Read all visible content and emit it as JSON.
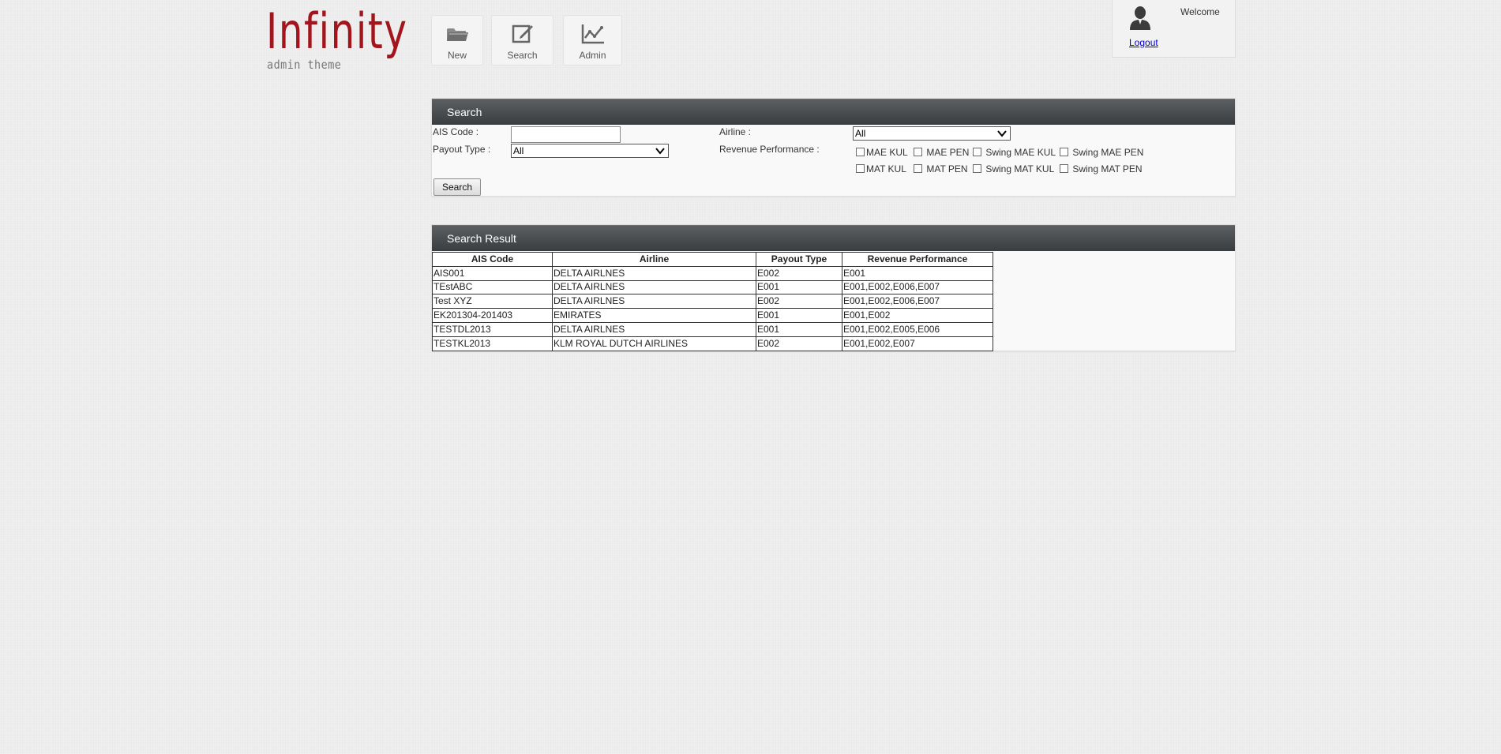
{
  "brand": {
    "name": "Infinity",
    "tagline": "admin theme",
    "color": "#a3151c"
  },
  "nav": [
    {
      "label": "New",
      "icon": "folder-icon"
    },
    {
      "label": "Search",
      "icon": "edit-icon"
    },
    {
      "label": "Admin",
      "icon": "chart-icon"
    }
  ],
  "user": {
    "welcome": "Welcome",
    "logout": "Logout",
    "icon": "user-icon"
  },
  "search_panel": {
    "title": "Search",
    "ais_code_label": "AIS Code :",
    "ais_code_value": "",
    "airline_label": "Airline :",
    "airline_selected": "All",
    "payout_type_label": "Payout Type :",
    "payout_type_selected": "All",
    "revenue_label": "Revenue Performance :",
    "revenue_options": [
      "MAE KUL",
      "MAE PEN",
      "Swing MAE KUL",
      "Swing MAE PEN",
      "MAT KUL",
      "MAT PEN",
      "Swing MAT KUL",
      "Swing MAT PEN"
    ],
    "search_button": "Search"
  },
  "result_panel": {
    "title": "Search Result",
    "columns": [
      "AIS Code",
      "Airline",
      "Payout Type",
      "Revenue Performance"
    ],
    "rows": [
      [
        "AIS001",
        "DELTA AIRLNES",
        "E002",
        "E001"
      ],
      [
        "TEstABC",
        "DELTA AIRLNES",
        "E001",
        "E001,E002,E006,E007"
      ],
      [
        "Test XYZ",
        "DELTA AIRLNES",
        "E002",
        "E001,E002,E006,E007"
      ],
      [
        "EK201304-201403",
        "EMIRATES",
        "E001",
        "E001,E002"
      ],
      [
        "TESTDL2013",
        "DELTA AIRLNES",
        "E001",
        "E001,E002,E005,E006"
      ],
      [
        "TESTKL2013",
        "KLM ROYAL DUTCH AIRLINES",
        "E002",
        "E001,E002,E007"
      ]
    ]
  },
  "colors": {
    "panel_header": "#4a4d50",
    "link": "#0000cc",
    "background": "#efefef"
  }
}
